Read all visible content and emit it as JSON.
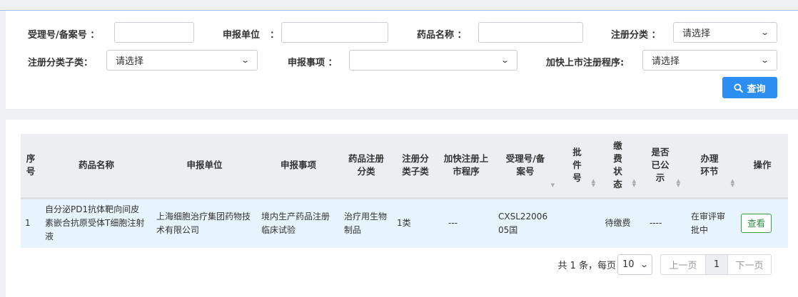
{
  "search": {
    "accept_no_label": "受理号/备案号 ：",
    "applicant_label": "申报单位",
    "applicant_colon": "：",
    "drug_name_label": "药品名称 ：",
    "reg_category_label": "注册分类 ：",
    "reg_category_value": "请选择",
    "reg_subcategory_label": "注册分类子类：",
    "reg_subcategory_value": "请选择",
    "application_item_label": "申报事项 ：",
    "application_item_value": "",
    "fast_track_label": "加快上市注册程序:",
    "fast_track_value": "请选择",
    "query_button": "查询"
  },
  "table": {
    "headers": {
      "seq": "序号",
      "drug_name": "药品名称",
      "applicant": "申报单位",
      "application_item": "申报事项",
      "reg_category": "药品注册分类",
      "reg_subcategory": "注册分类子类",
      "fast_track": "加快注册上市程序",
      "accept_no": "受理号/备案号",
      "approval_no": "批件号",
      "payment_status": "缴费状态",
      "published": "是否已公示",
      "stage": "办理环节",
      "action": "操作"
    },
    "rows": [
      {
        "seq": "1",
        "drug_name": "自分泌PD1抗体靶向间皮素嵌合抗原受体T细胞注射液",
        "applicant": "上海细胞治疗集团药物技术有限公司",
        "application_item": "境内生产药品注册临床试验",
        "reg_category": "治疗用生物制品",
        "reg_subcategory": "1类",
        "fast_track": "---",
        "accept_no": "CXSL2200605国",
        "approval_no": "",
        "payment_status": "待缴费",
        "published": "----",
        "stage": "在审评审批中",
        "action": "查看"
      }
    ]
  },
  "pagination": {
    "total_text": "共 1 条，每页",
    "page_size": "10",
    "prev": "上一页",
    "current": "1",
    "next": "下一页"
  },
  "colors": {
    "primary": "#2b8ef0",
    "view_button": "#3c9c4c",
    "row_highlight": "#e8f4fd",
    "header_bg": "#eceef1"
  }
}
